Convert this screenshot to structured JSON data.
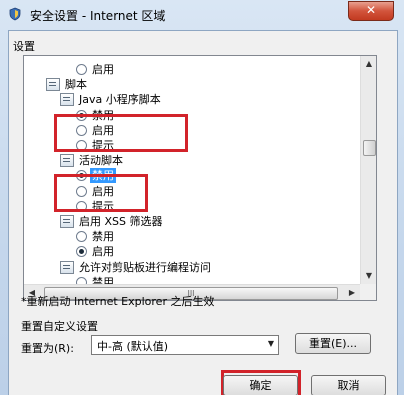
{
  "window": {
    "title": "安全设置 - Internet 区域",
    "close_glyph": "✕",
    "app_icon": "security-shield-icon"
  },
  "settings_label": "设置",
  "tree_items": [
    {
      "kind": "radio",
      "label": "启用",
      "checked": false
    },
    {
      "kind": "group",
      "label": "脚本"
    },
    {
      "kind": "group",
      "label": "Java 小程序脚本"
    },
    {
      "kind": "radio",
      "label": "禁用",
      "checked": true
    },
    {
      "kind": "radio",
      "label": "启用",
      "checked": false
    },
    {
      "kind": "radio",
      "label": "提示",
      "checked": false
    },
    {
      "kind": "group",
      "label": "活动脚本"
    },
    {
      "kind": "radio",
      "label": "禁用",
      "checked": true,
      "selected": true
    },
    {
      "kind": "radio",
      "label": "启用",
      "checked": false
    },
    {
      "kind": "radio",
      "label": "提示",
      "checked": false
    },
    {
      "kind": "group",
      "label": "启用 XSS 筛选器"
    },
    {
      "kind": "radio",
      "label": "禁用",
      "checked": false
    },
    {
      "kind": "radio",
      "label": "启用",
      "checked": true
    },
    {
      "kind": "group",
      "label": "允许对剪贴板进行编程访问"
    },
    {
      "kind": "radio",
      "label": "禁用",
      "checked": false
    }
  ],
  "scrollbar": {
    "up": "▲",
    "down": "▼",
    "left": "◀",
    "right": "▶",
    "grip": "III"
  },
  "restart_note": "*重新启动 Internet Explorer 之后生效",
  "reset": {
    "group_title": "重置自定义设置",
    "reset_to_label": "重置为(R):",
    "dropdown_value": "中-高 (默认值)",
    "dropdown_arrow": "▼",
    "reset_button": "重置(E)..."
  },
  "buttons": {
    "ok": "确定",
    "cancel": "取消"
  },
  "colors": {
    "highlight": "#d2232a",
    "selection": "#3399ff"
  }
}
